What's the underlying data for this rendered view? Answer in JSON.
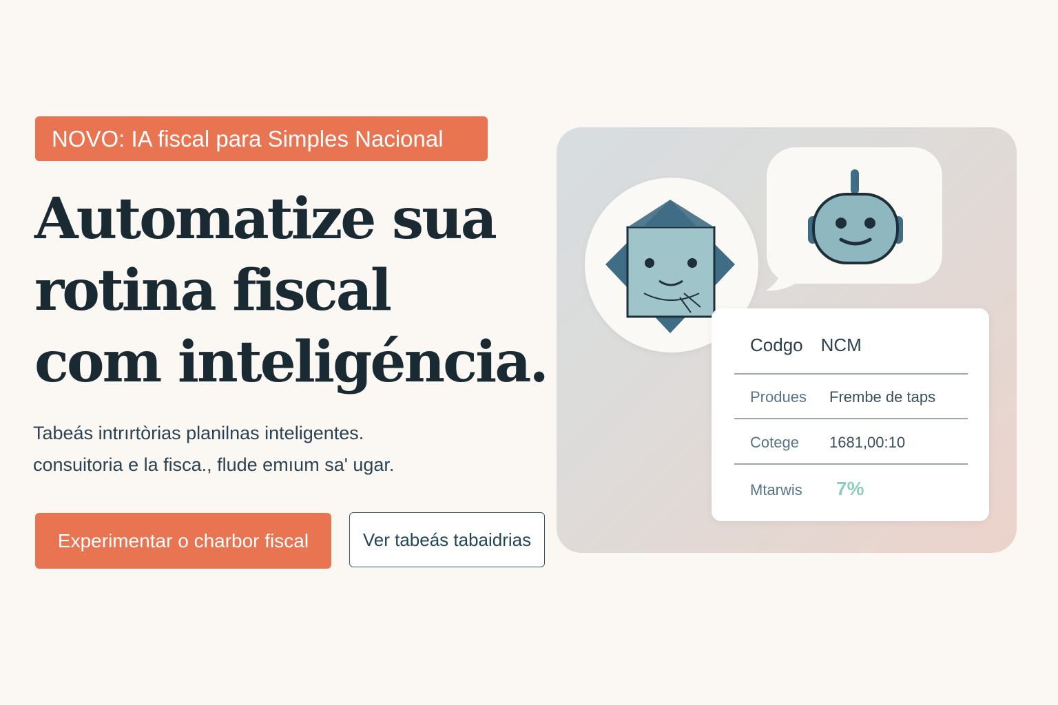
{
  "badge": {
    "label": "NOVO: IA fiscal para Simples Nacional"
  },
  "hero": {
    "headline": [
      "Automatize sua",
      "rotina fiscal",
      "com inteligéncia."
    ],
    "subtext": [
      "Tabeás intrırtòrias planilnas inteligentes.",
      "consuitoria e la fisca., flude emıum sa' ugar."
    ]
  },
  "actions": {
    "primary_label": "Experimentar o charbor fiscal",
    "secondary_label": "Ver tabeás tabaidrias"
  },
  "card": {
    "header_1": "Codgo",
    "header_2": "NCM",
    "rows": [
      {
        "key": "Produes",
        "value": "Frembe de taps"
      },
      {
        "key": "Cotege",
        "value": "1681,00:10"
      },
      {
        "key": "Mtarwis",
        "value": "7%"
      }
    ]
  },
  "colors": {
    "accent": "#e97452",
    "headline": "#1a2a33",
    "avatar_dark": "#3f6d85",
    "avatar_light": "#9fc4c9",
    "bot_face": "#8fb7c0"
  },
  "icons": {
    "avatar": "user-avatar-icon",
    "bot": "robot-icon"
  }
}
